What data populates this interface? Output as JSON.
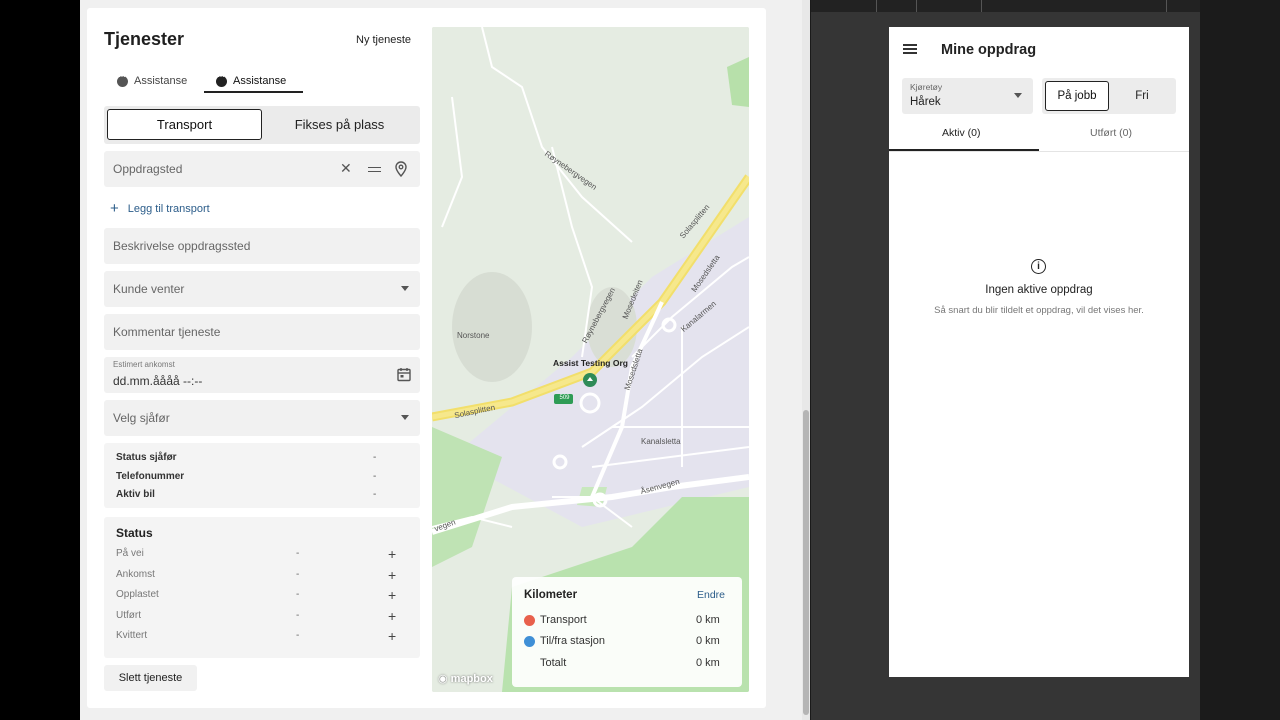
{
  "services": {
    "title": "Tjenester",
    "new_service": "Ny tjeneste",
    "tabs": [
      {
        "label": "Assistanse",
        "active": false
      },
      {
        "label": "Assistanse",
        "active": true
      }
    ],
    "segment": {
      "transport": "Transport",
      "fix_on_site": "Fikses på plass"
    },
    "mission_place": {
      "placeholder": "Oppdragsted"
    },
    "add_transport": "Legg til transport",
    "place_description": {
      "placeholder": "Beskrivelse oppdragssted"
    },
    "customer_waiting": {
      "placeholder": "Kunde venter"
    },
    "service_comment": {
      "placeholder": "Kommentar tjeneste"
    },
    "estimated_arrival": {
      "label": "Estimert ankomst",
      "value": "dd.mm.åååå --:--"
    },
    "select_driver": {
      "placeholder": "Velg sjåfør"
    },
    "driver_info": [
      {
        "label": "Status sjåfør",
        "value": "-"
      },
      {
        "label": "Telefonummer",
        "value": "-"
      },
      {
        "label": "Aktiv bil",
        "value": "-"
      }
    ],
    "status": {
      "title": "Status",
      "rows": [
        {
          "label": "På vei",
          "value": "-"
        },
        {
          "label": "Ankomst",
          "value": "-"
        },
        {
          "label": "Opplastet",
          "value": "-"
        },
        {
          "label": "Utført",
          "value": "-"
        },
        {
          "label": "Kvittert",
          "value": "-"
        }
      ]
    },
    "delete_service": "Slett tjeneste"
  },
  "map": {
    "labels": {
      "poi": "Assist Testing Org",
      "r1": "Røynebergvegen",
      "r2": "Røynebergvegen",
      "r3": "Solasplitten",
      "r4": "Solasplitten",
      "r5": "Mosedeiten",
      "r6": "Mosedsletta",
      "r7": "Mosedsletta",
      "r8": "Kanalarmen",
      "r9": "Kanalsletta",
      "r10": "Åsenvegen",
      "r11": "vegen",
      "place": "Norstone",
      "shield": "509"
    },
    "attribution": "mapbox",
    "kilometer": {
      "title": "Kilometer",
      "edit": "Endre",
      "rows": [
        {
          "label": "Transport",
          "value": "0 km",
          "color": "#e8604c"
        },
        {
          "label": "Til/fra stasjon",
          "value": "0 km",
          "color": "#3f8fd6"
        },
        {
          "label": "Totalt",
          "value": "0 km",
          "color": ""
        }
      ]
    }
  },
  "mobile": {
    "title": "Mine oppdrag",
    "vehicle": {
      "label": "Kjøretøy",
      "value": "Hårek"
    },
    "job_toggle": {
      "on": "På jobb",
      "off": "Fri"
    },
    "tabs": {
      "active": "Aktiv (0)",
      "done": "Utført (0)"
    },
    "empty": {
      "icon": "info-icon",
      "title": "Ingen aktive oppdrag",
      "subtitle": "Så snart du blir tildelt et oppdrag, vil det vises her."
    }
  },
  "colors": {
    "accent_link": "#2c5d8a",
    "road_yellow": "#f2df6b",
    "poi_green": "#2e8b57"
  }
}
